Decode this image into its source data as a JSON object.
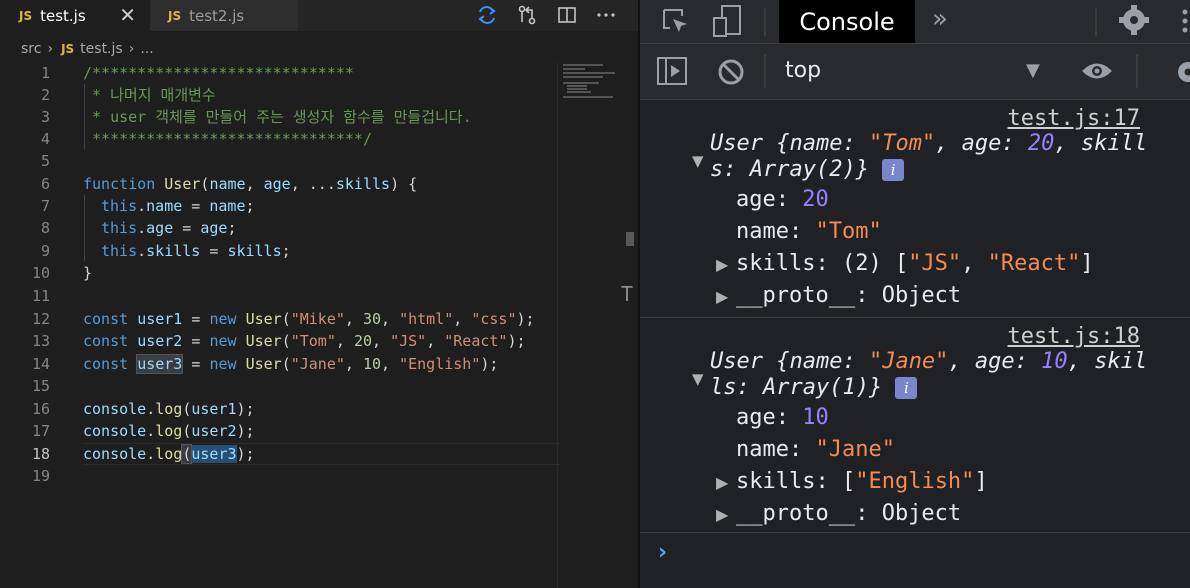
{
  "editor": {
    "tabs": [
      {
        "icon": "JS",
        "label": "test.js",
        "close": "✕"
      },
      {
        "icon": "JS",
        "label": "test2.js"
      }
    ],
    "breadcrumb": {
      "folder": "src",
      "icon": "JS",
      "file": "test.js",
      "ellipsis": "..."
    },
    "line_numbers": [
      "1",
      "2",
      "3",
      "4",
      "5",
      "6",
      "7",
      "8",
      "9",
      "10",
      "11",
      "12",
      "13",
      "14",
      "15",
      "16",
      "17",
      "18",
      "19"
    ],
    "code": {
      "l1": "/*****************************",
      "l2": " * 나머지 매개변수",
      "l3": " * user 객체를 만들어 주는 생성자 함수를 만들겁니다.",
      "l4": " ******************************/",
      "l6": [
        "function",
        " ",
        "User",
        "(",
        "name",
        ", ",
        "age",
        ", ...",
        "skills",
        ") {"
      ],
      "l7": [
        "this",
        ".",
        "name",
        " = ",
        "name",
        ";"
      ],
      "l8": [
        "this",
        ".",
        "age",
        " = ",
        "age",
        ";"
      ],
      "l9": [
        "this",
        ".",
        "skills",
        " = ",
        "skills",
        ";"
      ],
      "l10": "}",
      "l12": [
        "const",
        " ",
        "user1",
        " = ",
        "new",
        " ",
        "User",
        "(",
        "\"Mike\"",
        ", ",
        "30",
        ", ",
        "\"html\"",
        ", ",
        "\"css\"",
        ");"
      ],
      "l13": [
        "const",
        " ",
        "user2",
        " = ",
        "new",
        " ",
        "User",
        "(",
        "\"Tom\"",
        ", ",
        "20",
        ", ",
        "\"JS\"",
        ", ",
        "\"React\"",
        ");"
      ],
      "l14": [
        "const",
        " ",
        "user3",
        " = ",
        "new",
        " ",
        "User",
        "(",
        "\"Jane\"",
        ", ",
        "10",
        ", ",
        "\"English\"",
        ");"
      ],
      "l16": [
        "console",
        ".",
        "log",
        "(",
        "user1",
        ");"
      ],
      "l17": [
        "console",
        ".",
        "log",
        "(",
        "user2",
        ");"
      ],
      "l18": [
        "console",
        ".",
        "log",
        "(",
        "user3",
        ");"
      ]
    }
  },
  "devtools": {
    "tab": "Console",
    "more": "»",
    "context": "top",
    "messages": [
      {
        "source": "test.js:17",
        "summary_a": "User {name: ",
        "name_val": "\"Tom\"",
        "summary_b": ", age: ",
        "age_val": "20",
        "summary_c": ", skill",
        "summary_d": "s: Array(2)}",
        "props": {
          "age_key": "age: ",
          "age_val": "20",
          "name_key": "name: ",
          "name_val": "\"Tom\"",
          "skills_key": "skills: (2) [",
          "skills_v1": "\"JS\"",
          "skills_sep": ", ",
          "skills_v2": "\"React\"",
          "skills_end": "]",
          "proto": "__proto__: Object"
        }
      },
      {
        "source": "test.js:18",
        "summary_a": "User {name: ",
        "name_val": "\"Jane\"",
        "summary_b": ", age: ",
        "age_val": "10",
        "summary_c": ", skil",
        "summary_d": "ls: Array(1)}",
        "props": {
          "age_key": "age: ",
          "age_val": "10",
          "name_key": "name: ",
          "name_val": "\"Jane\"",
          "skills_key": "skills: [",
          "skills_v1": "\"English\"",
          "skills_end": "]",
          "proto": "__proto__: Object"
        }
      }
    ],
    "info_glyph": "i",
    "prompt": "›"
  },
  "colors": {
    "keyword": "#569cd6",
    "function": "#dcdcaa",
    "string": "#ce9178",
    "number": "#b5cea8",
    "comment": "#6a9955",
    "console_number": "#9980ff",
    "console_string": "#f28b54",
    "prompt": "#5e9cf7"
  }
}
